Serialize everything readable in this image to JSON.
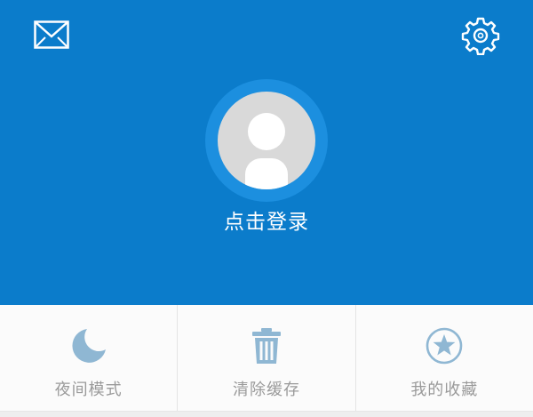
{
  "header": {
    "background_color": "#0b7ccb",
    "mail_icon": "mail-icon",
    "settings_icon": "gear-icon",
    "login_label": "点击登录"
  },
  "actions": [
    {
      "label": "夜间模式",
      "icon": "moon-icon"
    },
    {
      "label": "清除缓存",
      "icon": "trash-icon"
    },
    {
      "label": "我的收藏",
      "icon": "star-circle-icon"
    }
  ],
  "colors": {
    "accent": "#0b7ccb",
    "icon": "#8fb7d3",
    "label": "#9a9a9a"
  }
}
